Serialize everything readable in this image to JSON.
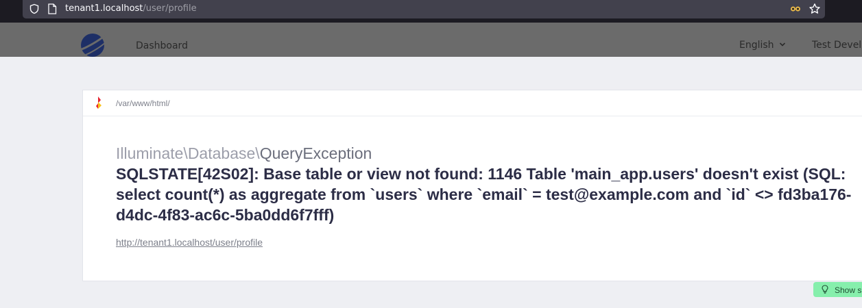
{
  "browser": {
    "url_host": "tenant1.localhost",
    "url_path": "/user/profile"
  },
  "nav": {
    "dashboard_label": "Dashboard",
    "language_label": "English",
    "user_label": "Test Develo"
  },
  "error": {
    "base_path": "/var/www/html/",
    "class_prefix": "Illuminate\\Database\\",
    "class_name": "QueryException",
    "message": "SQLSTATE[42S02]: Base table or view not found: 1146 Table 'main_app.users' doesn't exist (SQL: select count(*) as aggregate from `users` where `email` = test@example.com and `id` <> fd3ba176-d4dc-4f83-ac6c-5ba0dd6f7fff)",
    "url": "http://tenant1.localhost/user/profile"
  },
  "solutions": {
    "label": "Show s"
  },
  "colors": {
    "overlay": "#6b6b6b",
    "page_bg": "#eeeff3",
    "solution_green": "#86efac",
    "message_text": "#2c2d46"
  },
  "icons": [
    "shield-icon",
    "page-icon",
    "reader-mode-icon",
    "bookmark-star-icon",
    "app-logo",
    "chevron-down-icon",
    "ignition-icon",
    "lightbulb-icon"
  ]
}
